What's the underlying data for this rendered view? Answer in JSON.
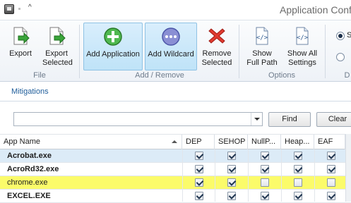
{
  "window": {
    "title": "Application Confi"
  },
  "ribbon": {
    "file_group": {
      "label": "File",
      "export": "Export",
      "export_selected": "Export Selected"
    },
    "add_remove_group": {
      "label": "Add / Remove",
      "add_application": "Add Application",
      "add_wildcard": "Add Wildcard",
      "remove_selected": "Remove Selected"
    },
    "options_group": {
      "label": "Options",
      "show_full_path": "Show Full Path",
      "show_all_settings": "Show All Settings"
    },
    "cut_group": {
      "label": "D",
      "radio1": "S",
      "radio2": ""
    }
  },
  "tabs": {
    "mitigations": "Mitigations"
  },
  "filter": {
    "value": "",
    "find": "Find",
    "clear": "Clear"
  },
  "grid": {
    "columns": [
      "App Name",
      "DEP",
      "SEHOP",
      "NullP...",
      "Heap...",
      "EAF"
    ],
    "rows": [
      {
        "name": "Acrobat.exe",
        "checks": [
          true,
          true,
          true,
          true,
          true
        ],
        "state": "selected"
      },
      {
        "name": "AcroRd32.exe",
        "checks": [
          true,
          true,
          true,
          true,
          true
        ],
        "state": "normal"
      },
      {
        "name": "chrome.exe",
        "checks": [
          true,
          true,
          false,
          false,
          false
        ],
        "state": "highlighted"
      },
      {
        "name": "EXCEL.EXE",
        "checks": [
          true,
          true,
          true,
          true,
          true
        ],
        "state": "normal"
      }
    ]
  },
  "colors": {
    "selection": "#dcebf7",
    "highlight": "#fbfb6a",
    "ribbon_selected": "#bfe3f8",
    "tab_text": "#1f5d9a"
  }
}
